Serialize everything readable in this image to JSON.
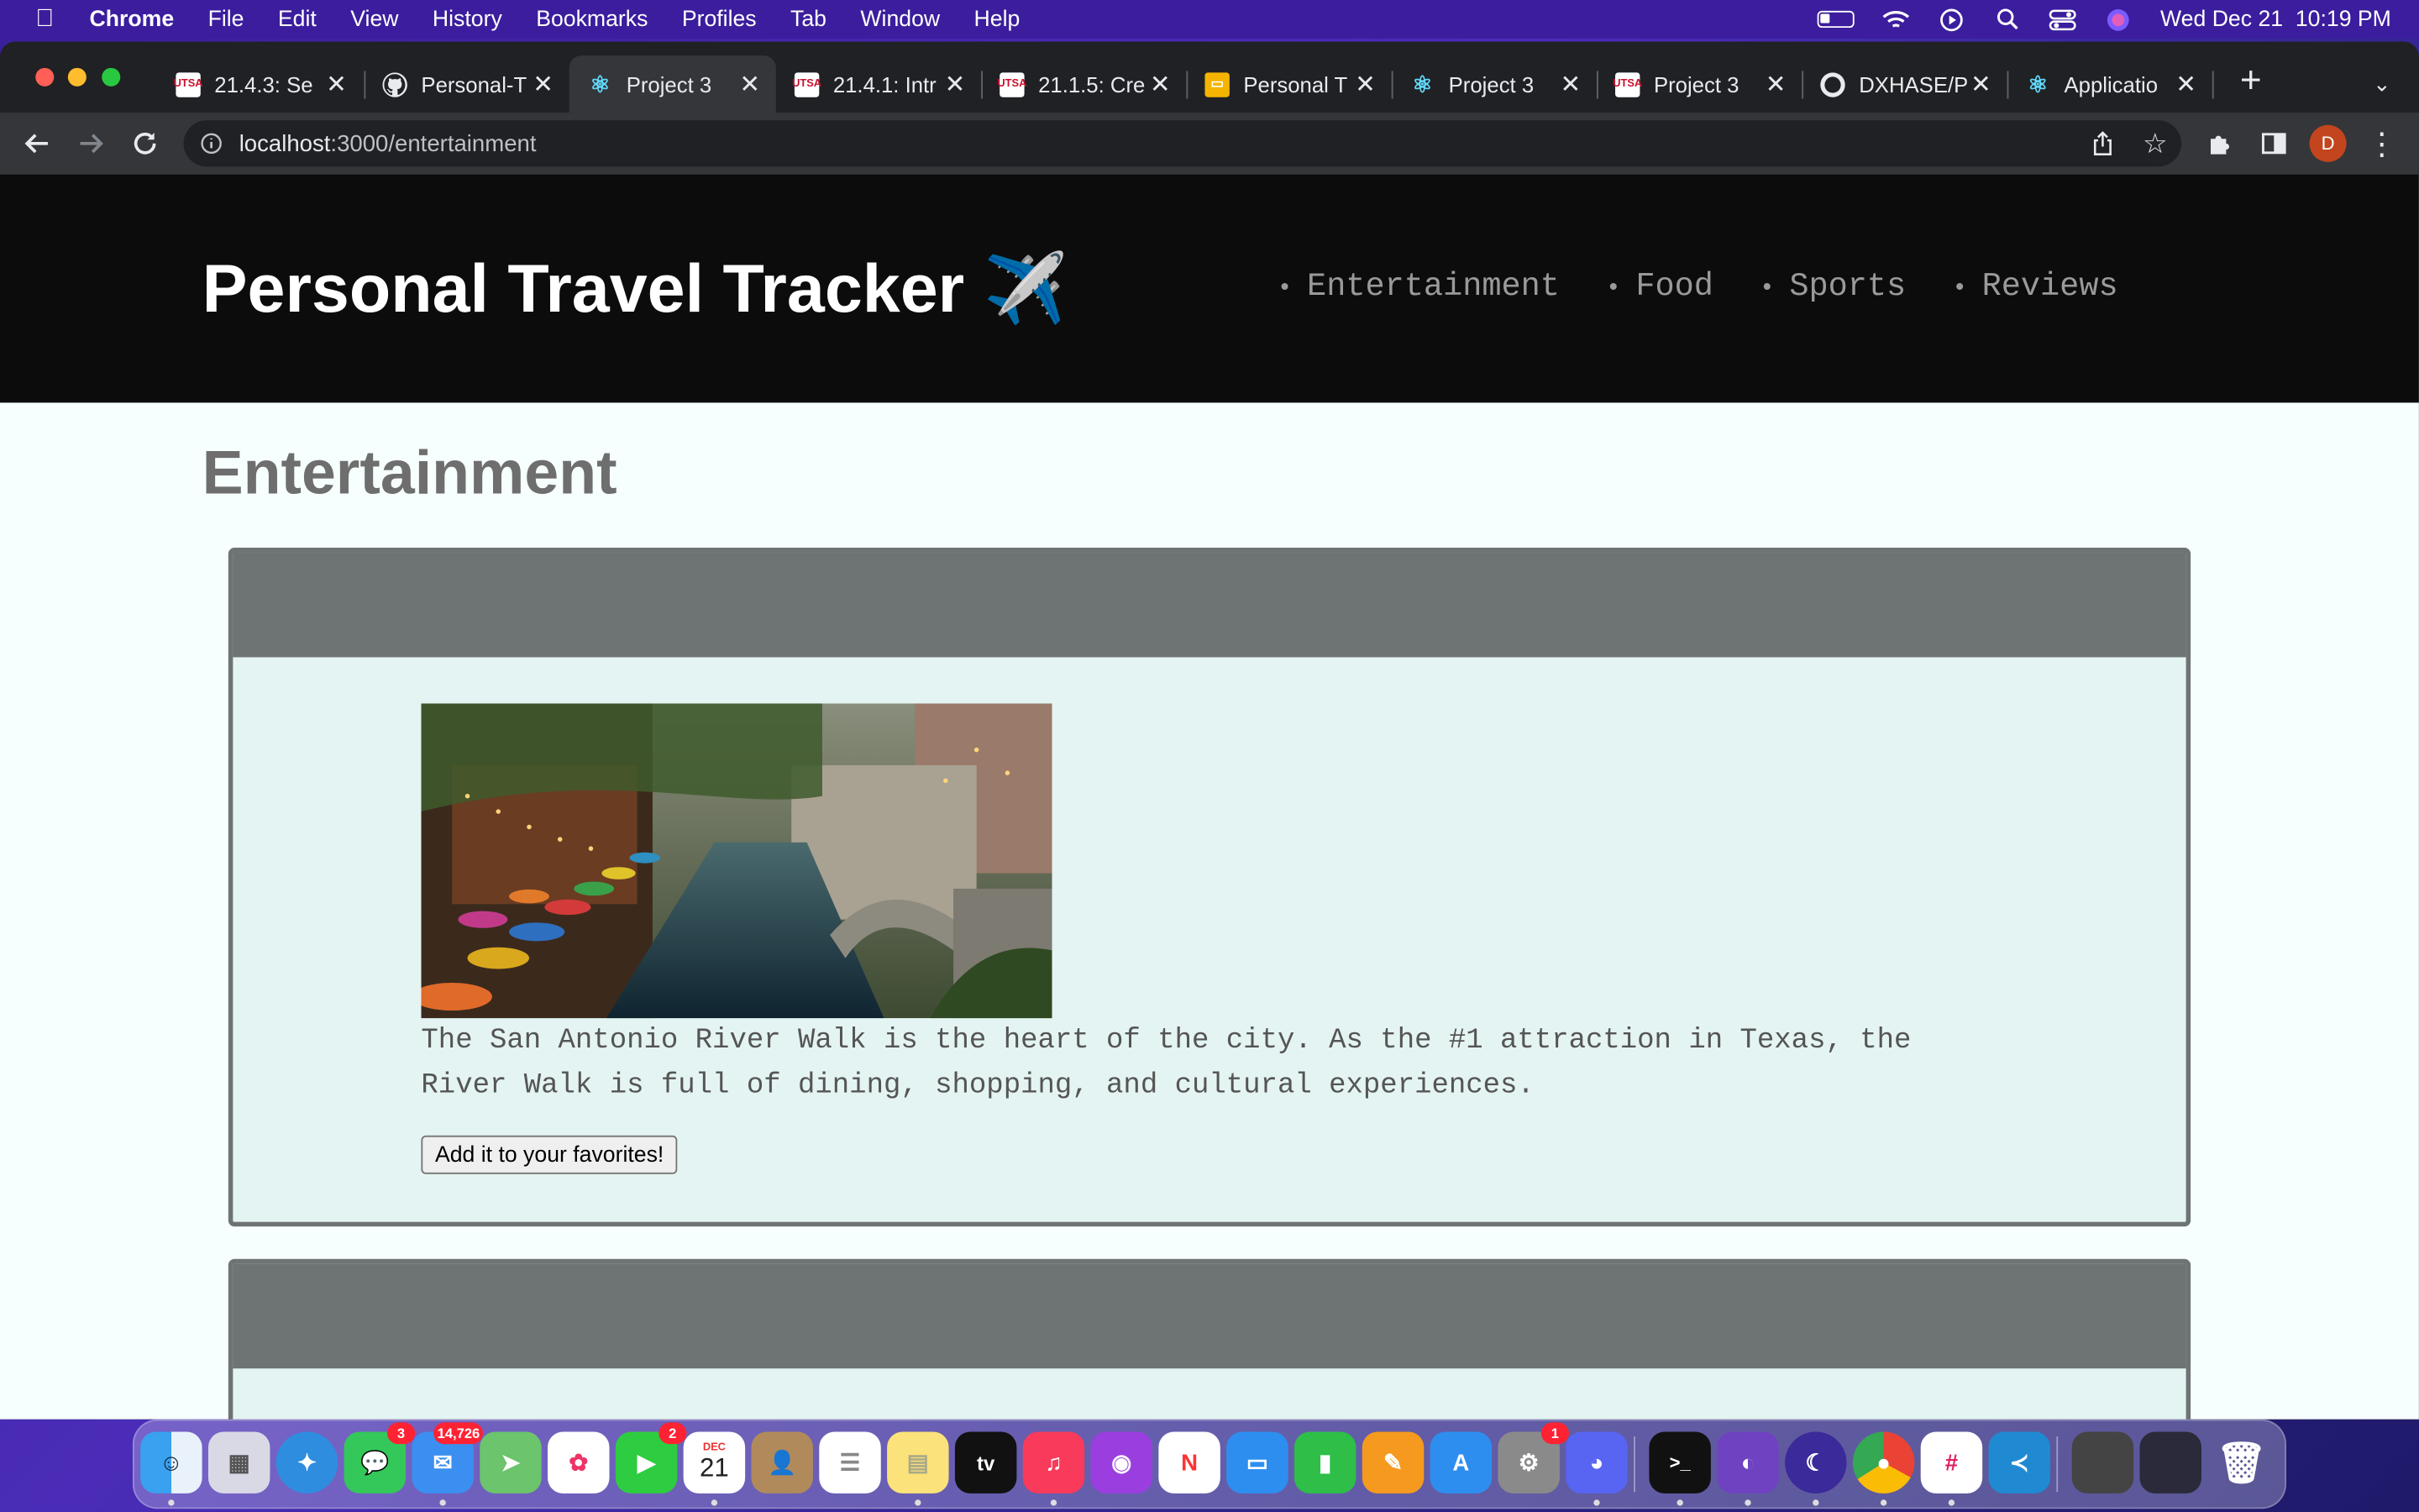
{
  "menubar": {
    "apple": "",
    "items": [
      "Chrome",
      "File",
      "Edit",
      "View",
      "History",
      "Bookmarks",
      "Profiles",
      "Tab",
      "Window",
      "Help"
    ],
    "datetime": "Wed Dec 21  10:19 PM"
  },
  "tabs": [
    {
      "title": "21.4.3: Se",
      "favicon": "utsa"
    },
    {
      "title": "Personal-T",
      "favicon": "github"
    },
    {
      "title": "Project 3",
      "favicon": "react",
      "active": true
    },
    {
      "title": "21.4.1: Intr",
      "favicon": "utsa"
    },
    {
      "title": "21.1.5: Cre",
      "favicon": "utsa"
    },
    {
      "title": "Personal T",
      "favicon": "slides"
    },
    {
      "title": "Project 3",
      "favicon": "react"
    },
    {
      "title": "Project 3",
      "favicon": "utsa"
    },
    {
      "title": "DXHASE/P",
      "favicon": "github"
    },
    {
      "title": "Applicatio",
      "favicon": "react"
    }
  ],
  "address": {
    "host": "localhost",
    "path": ":3000/entertainment"
  },
  "profile_initial": "D",
  "site": {
    "title": "Personal Travel Tracker ✈️",
    "nav": [
      "Entertainment",
      "Food",
      "Sports",
      "Reviews"
    ]
  },
  "page_title": "Entertainment",
  "cards": [
    {
      "description": "The San Antonio River Walk is the heart of the city. As the #1 attraction in Texas, the River Walk is full of dining, shopping, and cultural experiences.",
      "button": "Add it to your favorites!"
    }
  ],
  "dock": {
    "mail_badge": "14,726",
    "messages_badge": "3",
    "facetime_badge": "2",
    "calendar_month": "DEC",
    "calendar_day": "21",
    "settings_badge": "1",
    "appletv_label": "tv"
  }
}
